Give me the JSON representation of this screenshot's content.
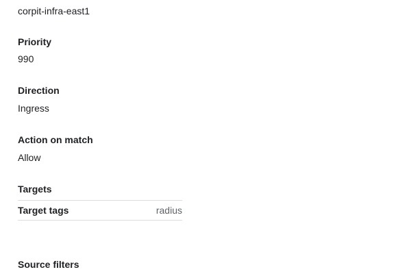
{
  "network": {
    "value": "corpit-infra-east1"
  },
  "priority": {
    "label": "Priority",
    "value": "990"
  },
  "direction": {
    "label": "Direction",
    "value": "Ingress"
  },
  "action": {
    "label": "Action on match",
    "value": "Allow"
  },
  "targets": {
    "label": "Targets",
    "rows": [
      {
        "key": "Target tags",
        "value": "radius"
      }
    ]
  },
  "source_filters": {
    "label": "Source filters"
  }
}
